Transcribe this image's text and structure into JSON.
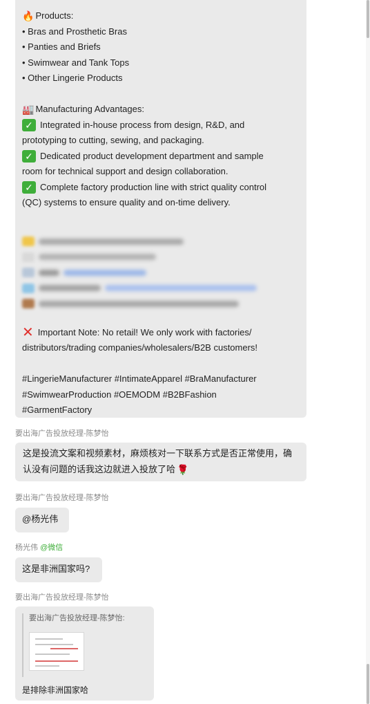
{
  "messages": {
    "main": {
      "products_heading": "Products:",
      "products": [
        "Bras and Prosthetic Bras",
        "Panties and Briefs",
        "Swimwear and Tank Tops",
        "Other Lingerie Products"
      ],
      "advantages_heading": "Manufacturing Advantages:",
      "advantages": [
        [
          "Integrated in-house process from design, R&D, and",
          "prototyping to cutting, sewing, and packaging."
        ],
        [
          "Dedicated product development department and sample",
          "room for technical support and design collaboration."
        ],
        [
          "Complete factory production line with strict quality control",
          "(QC) systems to ensure quality and on-time delivery."
        ]
      ],
      "note": [
        "Important Note: No retail! We only work with factories/",
        "distributors/trading companies/wholesalers/B2B customers!"
      ],
      "hashtags": [
        "#LingerieManufacturer #IntimateApparel #BraManufacturer",
        "#SwimwearProduction #OEMODM #B2BFashion",
        "#GarmentFactory"
      ]
    },
    "msg2": {
      "sender": "要出海广告投放经理-陈梦怡",
      "text": [
        "这是投流文案和视频素材，麻烦核对一下联系方式是否正常使用，确",
        "认没有问题的话我这边就进入投放了哈"
      ]
    },
    "msg3": {
      "sender": "要出海广告投放经理-陈梦怡",
      "text": "@杨光伟"
    },
    "msg4": {
      "sender": "杨光伟",
      "sender_tag": "@微信",
      "text": "这是非洲国家吗?"
    },
    "msg5": {
      "sender": "要出海广告投放经理-陈梦怡",
      "quote_sender": "要出海广告投放经理-陈梦怡:",
      "reply": "是排除非洲国家哈"
    }
  },
  "icons": {
    "products": "fire-icon",
    "advantages": "factory-icon",
    "advantage_item": "check-mark-icon",
    "note": "cross-mark-icon",
    "flower": "rose-icon"
  },
  "colors": {
    "bubble": "#eaeaea",
    "check": "#3fae3a",
    "cross": "#e0302d",
    "sender": "#8a8a8a",
    "tag": "#3fae3a"
  }
}
